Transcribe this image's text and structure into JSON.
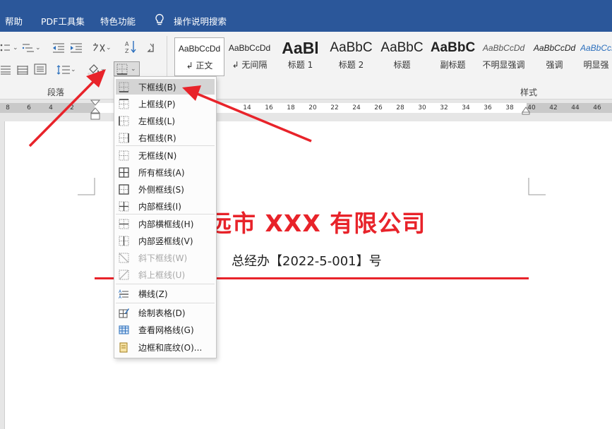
{
  "menu": {
    "help": "帮助",
    "pdf_tools": "PDF工具集",
    "features": "特色功能",
    "search": "操作说明搜索"
  },
  "ribbon": {
    "paragraph_group": "段落",
    "styles_group": "样式",
    "styles": [
      {
        "sample": "AaBbCcDd",
        "name": "↲ 正文",
        "selected": true
      },
      {
        "sample": "AaBbCcDd",
        "name": "↲ 无间隔"
      },
      {
        "sample": "AaBl",
        "name": "标题 1"
      },
      {
        "sample": "AaBbC",
        "name": "标题 2"
      },
      {
        "sample": "AaBbC",
        "name": "标题"
      },
      {
        "sample": "AaBbC",
        "name": "副标题"
      },
      {
        "sample": "AaBbCcDd",
        "name": "不明显强调"
      },
      {
        "sample": "AaBbCcDd",
        "name": "强调"
      },
      {
        "sample": "AaBbCcDd",
        "name": "明显强"
      }
    ]
  },
  "ruler": {
    "numbers": [
      "8",
      "6",
      "4",
      "2",
      "14",
      "16",
      "18",
      "20",
      "22",
      "24",
      "26",
      "28",
      "30",
      "32",
      "34",
      "36",
      "38",
      "40",
      "42",
      "44",
      "46"
    ]
  },
  "border_menu": {
    "items": [
      {
        "label": "下框线(B)",
        "icon": "bottom-border-icon"
      },
      {
        "label": "上框线(P)",
        "icon": "top-border-icon"
      },
      {
        "label": "左框线(L)",
        "icon": "left-border-icon"
      },
      {
        "label": "右框线(R)",
        "icon": "right-border-icon"
      },
      {
        "label": "无框线(N)",
        "icon": "no-border-icon"
      },
      {
        "label": "所有框线(A)",
        "icon": "all-borders-icon"
      },
      {
        "label": "外侧框线(S)",
        "icon": "outside-borders-icon"
      },
      {
        "label": "内部框线(I)",
        "icon": "inside-borders-icon"
      },
      {
        "label": "内部横框线(H)",
        "icon": "inside-horizontal-border-icon"
      },
      {
        "label": "内部竖框线(V)",
        "icon": "inside-vertical-border-icon"
      },
      {
        "label": "斜下框线(W)",
        "icon": "diagonal-down-border-icon"
      },
      {
        "label": "斜上框线(U)",
        "icon": "diagonal-up-border-icon"
      },
      {
        "label": "横线(Z)",
        "icon": "horizontal-line-icon"
      },
      {
        "label": "绘制表格(D)",
        "icon": "draw-table-icon"
      },
      {
        "label": "查看网格线(G)",
        "icon": "view-gridlines-icon"
      },
      {
        "label": "边框和底纹(O)...",
        "icon": "borders-shading-icon"
      }
    ]
  },
  "document": {
    "title": "远市 XXX 有限公司",
    "number": "总经办【2022-5-001】号"
  },
  "colors": {
    "menubar": "#2b579a",
    "accent_red": "#e8232a",
    "arrow_red": "#e8232a"
  }
}
